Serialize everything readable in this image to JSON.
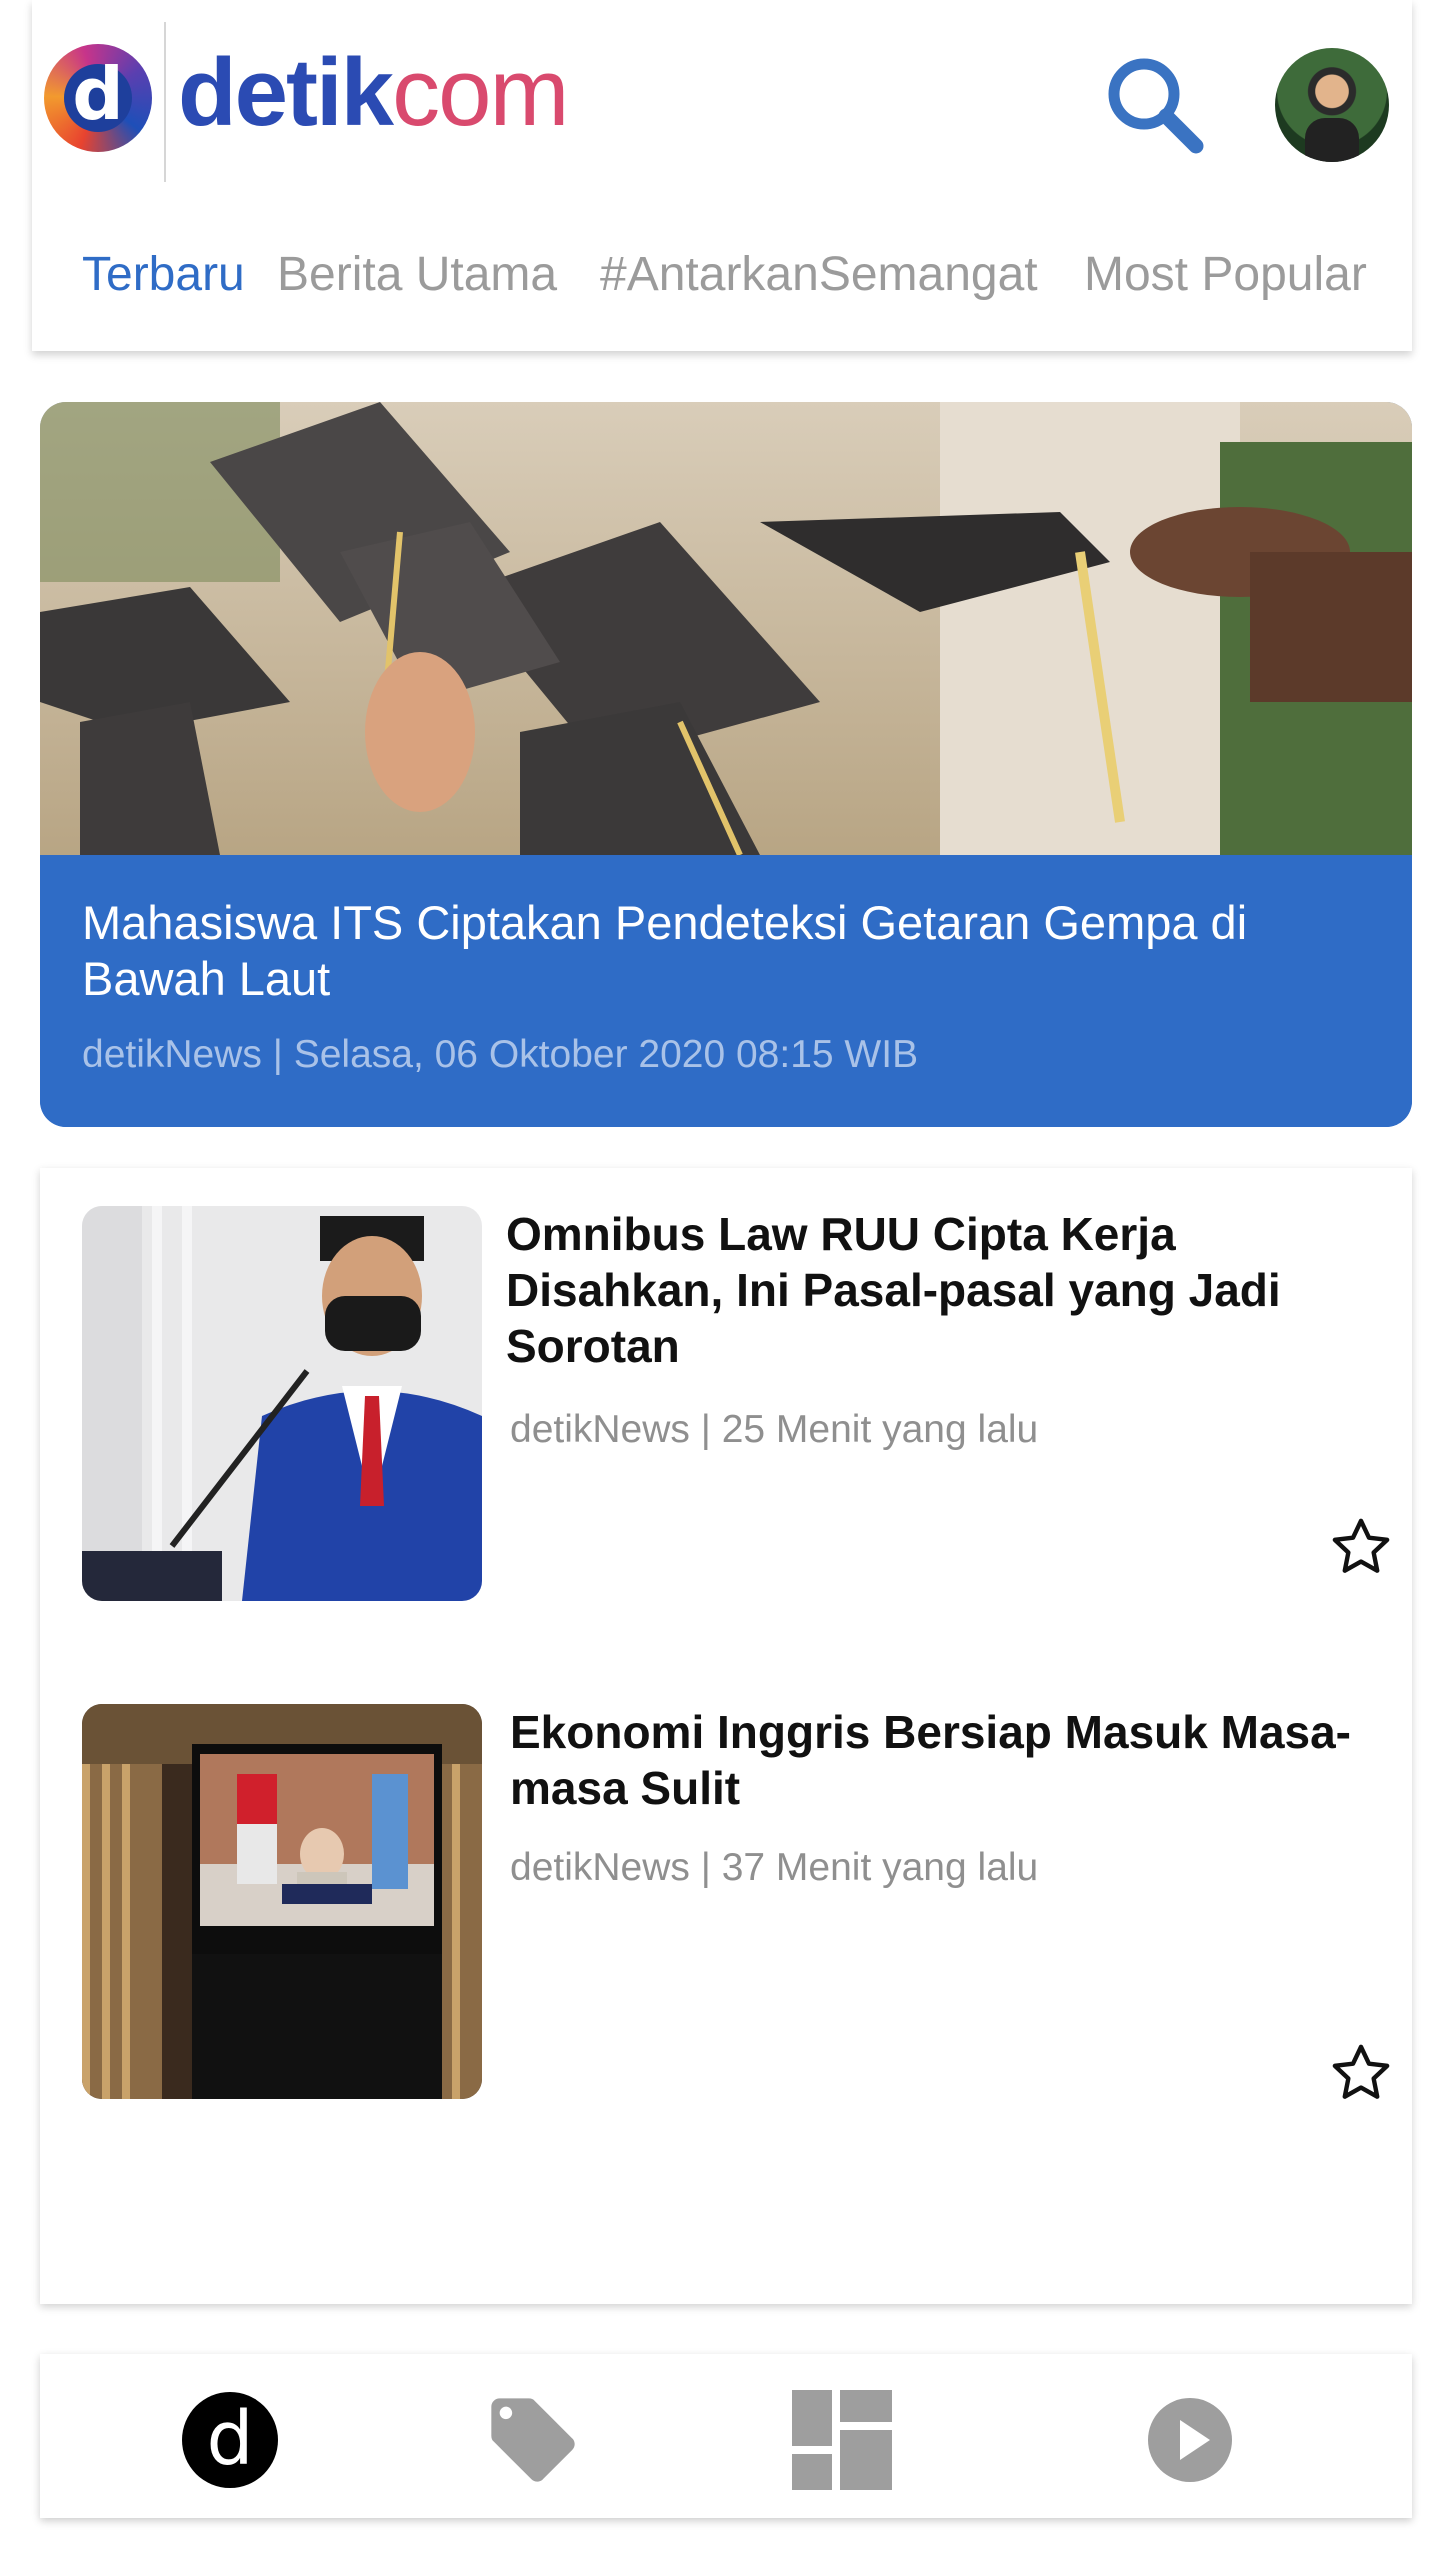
{
  "header": {
    "logo_mark": "d",
    "logo_text_part1": "detik",
    "logo_text_part2": "com",
    "tabs": [
      {
        "label": "Terbaru",
        "active": true
      },
      {
        "label": "Berita Utama",
        "active": false
      },
      {
        "label": "#AntarkanSemangat",
        "active": false
      },
      {
        "label": "Most Popular",
        "active": false
      }
    ]
  },
  "hero": {
    "title": "Mahasiswa ITS Ciptakan Pendeteksi Getaran Gempa di Bawah Laut",
    "meta": "detikNews | Selasa, 06 Oktober 2020 08:15 WIB"
  },
  "articles": [
    {
      "title": "Omnibus Law RUU Cipta Kerja Disahkan, Ini Pasal-pasal yang Jadi Sorotan",
      "meta": "detikNews | 25 Menit yang lalu"
    },
    {
      "title": "Ekonomi Inggris Bersiap Masuk Masa-masa Sulit",
      "meta": "detikNews | 37 Menit yang lalu"
    }
  ],
  "bottom_nav": {
    "items": [
      "home-icon",
      "tag-icon",
      "dashboard-icon",
      "play-icon"
    ],
    "home_mark": "d"
  },
  "colors": {
    "accent_blue": "#2f6cc6",
    "inactive_gray": "#9b9b9b",
    "nav_gray": "#9e9e9e"
  }
}
